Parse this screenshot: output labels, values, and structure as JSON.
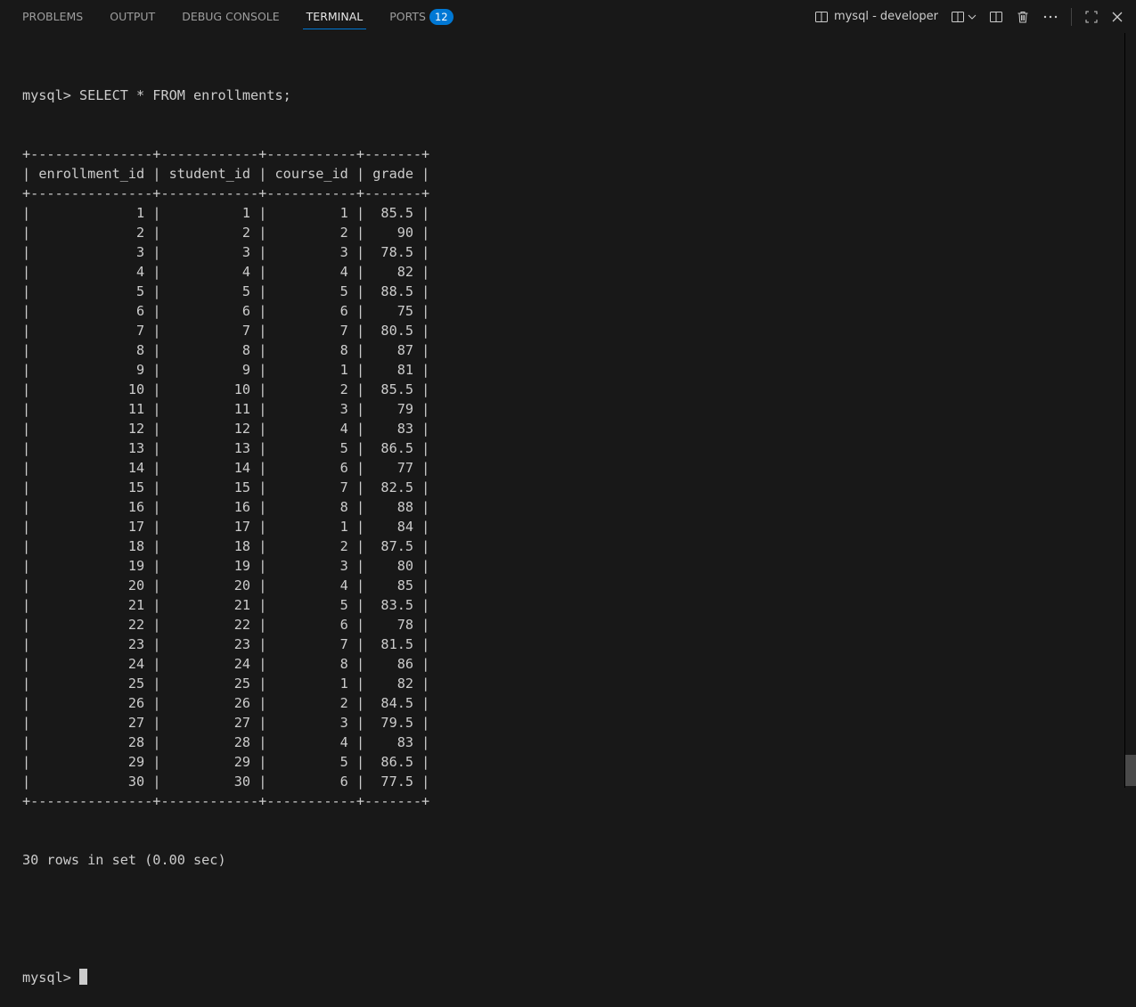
{
  "tabs": [
    {
      "label": "PROBLEMS"
    },
    {
      "label": "OUTPUT"
    },
    {
      "label": "DEBUG CONSOLE"
    },
    {
      "label": "TERMINAL",
      "active": true
    },
    {
      "label": "PORTS",
      "badge": "12"
    }
  ],
  "terminal_title": "mysql - developer",
  "command_line": "mysql> SELECT * FROM enrollments;",
  "columns": [
    "enrollment_id",
    "student_id",
    "course_id",
    "grade"
  ],
  "rows": [
    [
      1,
      1,
      1,
      "85.5"
    ],
    [
      2,
      2,
      2,
      "90"
    ],
    [
      3,
      3,
      3,
      "78.5"
    ],
    [
      4,
      4,
      4,
      "82"
    ],
    [
      5,
      5,
      5,
      "88.5"
    ],
    [
      6,
      6,
      6,
      "75"
    ],
    [
      7,
      7,
      7,
      "80.5"
    ],
    [
      8,
      8,
      8,
      "87"
    ],
    [
      9,
      9,
      1,
      "81"
    ],
    [
      10,
      10,
      2,
      "85.5"
    ],
    [
      11,
      11,
      3,
      "79"
    ],
    [
      12,
      12,
      4,
      "83"
    ],
    [
      13,
      13,
      5,
      "86.5"
    ],
    [
      14,
      14,
      6,
      "77"
    ],
    [
      15,
      15,
      7,
      "82.5"
    ],
    [
      16,
      16,
      8,
      "88"
    ],
    [
      17,
      17,
      1,
      "84"
    ],
    [
      18,
      18,
      2,
      "87.5"
    ],
    [
      19,
      19,
      3,
      "80"
    ],
    [
      20,
      20,
      4,
      "85"
    ],
    [
      21,
      21,
      5,
      "83.5"
    ],
    [
      22,
      22,
      6,
      "78"
    ],
    [
      23,
      23,
      7,
      "81.5"
    ],
    [
      24,
      24,
      8,
      "86"
    ],
    [
      25,
      25,
      1,
      "82"
    ],
    [
      26,
      26,
      2,
      "84.5"
    ],
    [
      27,
      27,
      3,
      "79.5"
    ],
    [
      28,
      28,
      4,
      "83"
    ],
    [
      29,
      29,
      5,
      "86.5"
    ],
    [
      30,
      30,
      6,
      "77.5"
    ]
  ],
  "result_summary": "30 rows in set (0.00 sec)",
  "prompt": "mysql> "
}
